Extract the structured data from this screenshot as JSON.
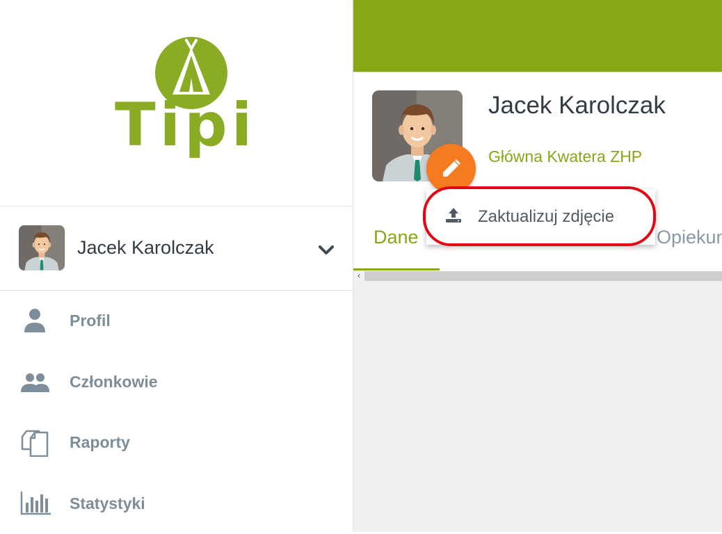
{
  "brand": {
    "name": "Tipi",
    "color": "#8aab24"
  },
  "user": {
    "name": "Jacek Karolczak",
    "avatar_icon": "user-avatar-icon",
    "chevron_icon": "chevron-down-icon"
  },
  "nav": {
    "items": [
      {
        "label": "Profil",
        "icon": "person-icon"
      },
      {
        "label": "Członkowie",
        "icon": "group-icon"
      },
      {
        "label": "Raporty",
        "icon": "documents-icon"
      },
      {
        "label": "Statystyki",
        "icon": "bar-chart-icon"
      }
    ]
  },
  "profile": {
    "name": "Jacek Karolczak",
    "organization": "Główna Kwatera ZHP",
    "edit_icon": "pencil-icon"
  },
  "tabs": [
    {
      "label": "Dane",
      "active": true
    },
    {
      "label": "Opiekun",
      "active": false
    }
  ],
  "photo_menu": {
    "items": [
      {
        "label": "Zaktualizuj zdjęcie",
        "icon": "upload-icon"
      }
    ]
  },
  "colors": {
    "accent": "#87a717",
    "fab": "#f47b20",
    "highlight": "#e30613",
    "nav_text": "#7d8e9a"
  }
}
